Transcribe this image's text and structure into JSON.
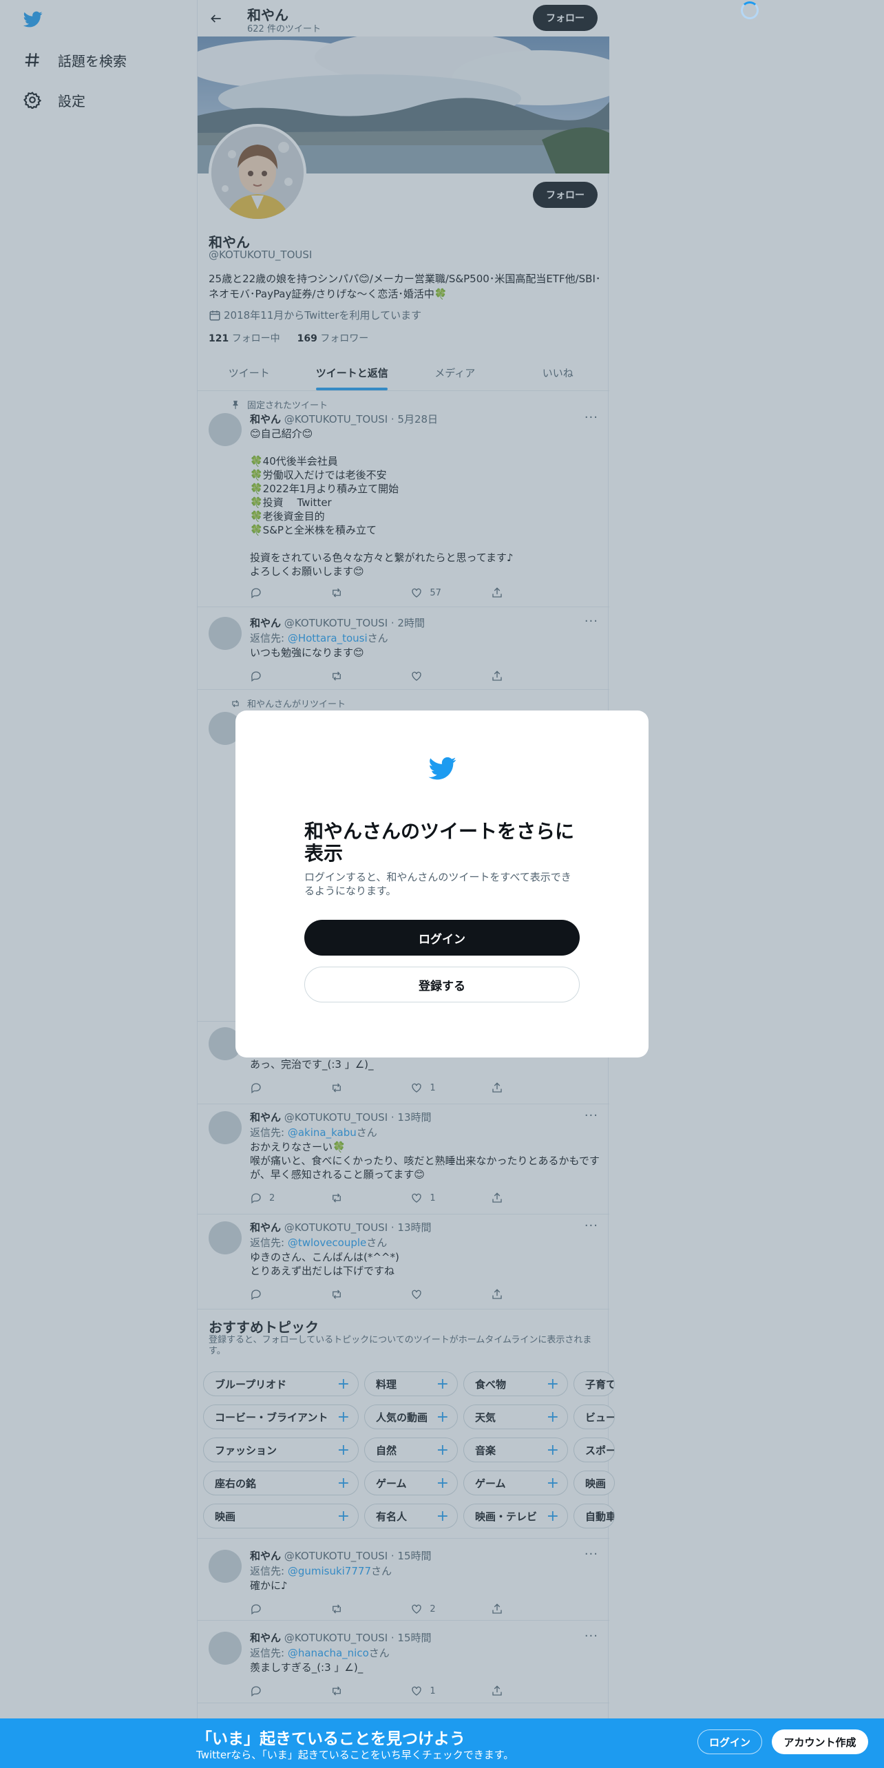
{
  "sidebar": {
    "items": [
      {
        "icon": "hashtag-icon",
        "label": "話題を検索"
      },
      {
        "icon": "gear-icon",
        "label": "設定"
      }
    ]
  },
  "header": {
    "name": "和やん",
    "tweet_count": "622 件のツイート",
    "follow_label": "フォロー"
  },
  "profile": {
    "name": "和やん",
    "handle": "@KOTUKOTU_TOUSI",
    "bio": "25歳と22歳の娘を持つシンパパ😊/メーカー営業職/S&P500･米国高配当ETF他/SBI･ネオモバ･PayPay証券/さりげな〜く恋活･婚活中🍀",
    "joined": "2018年11月からTwitterを利用しています",
    "following_count": "121",
    "following_label": "フォロー中",
    "followers_count": "169",
    "followers_label": "フォロワー",
    "follow_label": "フォロー"
  },
  "tabs": [
    {
      "label": "ツイート",
      "active": false
    },
    {
      "label": "ツイートと返信",
      "active": true
    },
    {
      "label": "メディア",
      "active": false
    },
    {
      "label": "いいね",
      "active": false
    }
  ],
  "tweets": [
    {
      "context": "固定されたツイート",
      "name": "和やん",
      "meta": "@KOTUKOTU_TOUSI · 5月28日",
      "body": "😊自己紹介😊\n\n🍀40代後半会社員\n🍀労働収入だけでは老後不安\n🍀2022年1月より積み立て開始\n🍀投資　 Twitter\n🍀老後資金目的\n🍀S&Pと全米株を積み立て\n\n投資をされている色々な方々と繋がれたらと思ってます♪\nよろしくお願いします😊",
      "likes": "57"
    },
    {
      "name": "和やん",
      "meta": "@KOTUKOTU_TOUSI · 2時間",
      "reply_prefix": "返信先: ",
      "reply_to": "@Hottara_tousi",
      "reply_suffix": "さん",
      "body": "いつも勉強になります😊",
      "likes": ""
    },
    {
      "context": "和やんさんがリツイート"
    },
    {
      "body": "あっ、完治です_(:3 」∠)_",
      "likes": "1"
    },
    {
      "name": "和やん",
      "meta": "@KOTUKOTU_TOUSI · 13時間",
      "reply_prefix": "返信先: ",
      "reply_to": "@akina_kabu",
      "reply_suffix": "さん",
      "body": "おかえりなさーい🍀\n喉が痛いと、食べにくかったり、咳だと熟睡出来なかったりとあるかもですが、早く感知されること願ってます😊",
      "replies": "2",
      "likes": "1"
    },
    {
      "name": "和やん",
      "meta": "@KOTUKOTU_TOUSI · 13時間",
      "reply_prefix": "返信先: ",
      "reply_to": "@twlovecouple",
      "reply_suffix": "さん",
      "body": "ゆきのさん、こんばんは(*^^*)\nとりあえず出だしは下げですね",
      "likes": ""
    },
    {
      "name": "和やん",
      "meta": "@KOTUKOTU_TOUSI · 15時間",
      "reply_prefix": "返信先: ",
      "reply_to": "@gumisuki7777",
      "reply_suffix": "さん",
      "body": "確かに♪",
      "likes": "2"
    },
    {
      "name": "和やん",
      "meta": "@KOTUKOTU_TOUSI · 15時間",
      "reply_prefix": "返信先: ",
      "reply_to": "@hanacha_nico",
      "reply_suffix": "さん",
      "body": "羨ましすぎる_(:3 」∠)_",
      "likes": "1"
    }
  ],
  "topics": {
    "title": "おすすめトピック",
    "subtitle": "登録すると、フォローしているトピックについてのツイートがホームタイムラインに表示されます。",
    "rows": [
      [
        "ブループリオド",
        "料理",
        "食べ物",
        "子育て"
      ],
      [
        "コービー・ブライアント",
        "人気の動画",
        "天気",
        "ビューテ"
      ],
      [
        "ファッション",
        "自然",
        "音楽",
        "スポーツ"
      ],
      [
        "座右の銘",
        "ゲーム",
        "ゲーム",
        "映画"
      ],
      [
        "映画",
        "有名人",
        "映画・テレビ",
        "自動車"
      ]
    ]
  },
  "modal": {
    "title": "和やんさんのツイートをさらに表示",
    "subtitle": "ログインすると、和やんさんのツイートをすべて表示できるようになります。",
    "login": "ログイン",
    "signup": "登録する"
  },
  "bottom_bar": {
    "title": "「いま」起きていることを見つけよう",
    "subtitle": "Twitterなら、「いま」起きていることをいち早くチェックできます。",
    "login": "ログイン",
    "signup": "アカウント作成"
  },
  "colors": {
    "accent": "#1d9bf0",
    "text": "#0f1419",
    "secondary": "#536471"
  }
}
